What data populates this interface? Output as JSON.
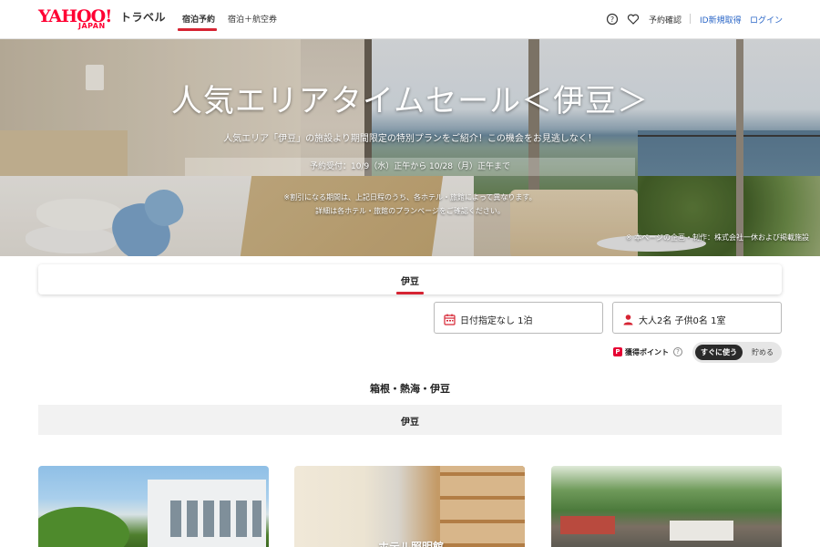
{
  "header": {
    "logo_main": "YAHOO!",
    "logo_sub": "JAPAN",
    "logo_service": "トラベル",
    "tabs": [
      {
        "label": "宿泊予約",
        "active": true
      },
      {
        "label": "宿泊＋航空券",
        "active": false
      }
    ],
    "help_icon": "question-circle-icon",
    "favorite_icon": "heart-icon",
    "reservation_link": "予約確認",
    "signup_link": "ID新規取得",
    "login_link": "ログイン"
  },
  "hero": {
    "title": "人気エリアタイムセール＜伊豆＞",
    "subtitle": "人気エリア「伊豆」の施設より期間限定の特別プランをご紹介！この機会をお見逃しなく！",
    "period": "予約受付：10/9（水）正午から 10/28（月）正午まで",
    "note_line1": "※割引になる期間は、上記日程のうち、各ホテル・旅館によって異なります。",
    "note_line2": "詳細は各ホテル・旅館のプランページをご確認ください。",
    "credit": "※ 本ページの企画・制作：株式会社一休および掲載施設"
  },
  "area_tabs": [
    {
      "label": "伊豆",
      "active": true
    }
  ],
  "search": {
    "date_value": "日付指定なし 1泊",
    "guests_value": "大人2名 子供0名 1室",
    "date_icon": "calendar-icon",
    "guests_icon": "person-icon"
  },
  "points": {
    "logo": "P",
    "label": "獲得ポイント",
    "help": "?",
    "toggle_use": "すぐに使う",
    "toggle_save": "貯める"
  },
  "region": {
    "title": "箱根・熱海・伊豆",
    "row_label": "伊豆"
  },
  "cards": [
    {
      "label": ""
    },
    {
      "label": "ホテル照明館"
    },
    {
      "label": ""
    }
  ],
  "colors": {
    "brand_red": "#ff0033",
    "accent_red": "#d62433",
    "link_blue": "#2a66c7",
    "toggle_dark": "#2a2a2a"
  }
}
